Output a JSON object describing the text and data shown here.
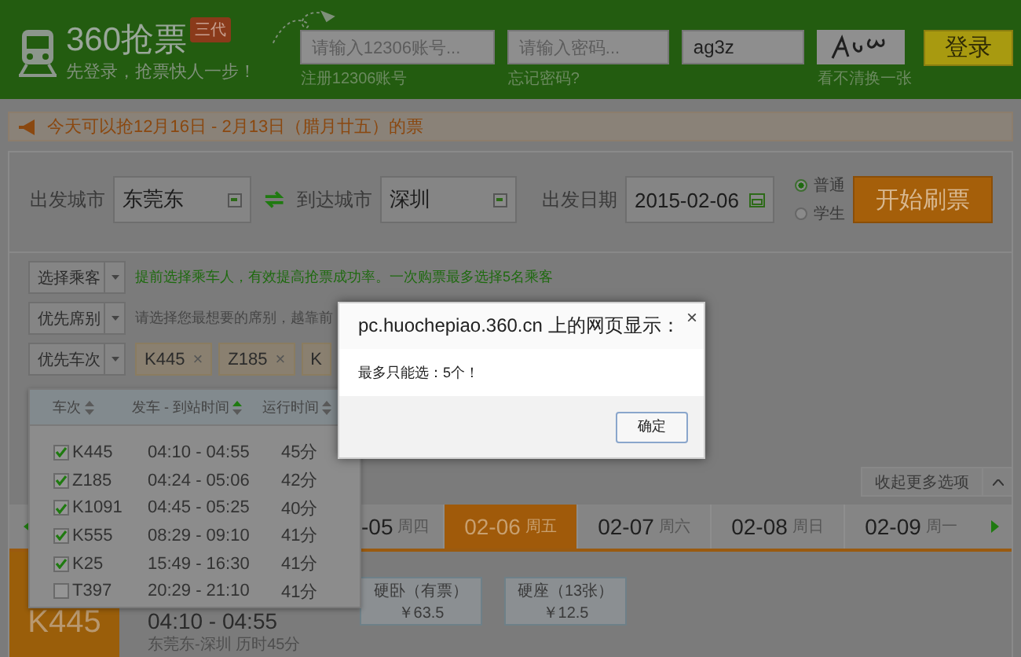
{
  "header": {
    "logo_text": "360抢票",
    "badge": "三代",
    "slogan": "先登录，抢票快人一步！",
    "login": {
      "account": {
        "placeholder": "请输入12306账号...",
        "link": "注册12306账号"
      },
      "password": {
        "placeholder": "请输入密码...",
        "link": "忘记密码?"
      },
      "captcha": {
        "value": "ag3z",
        "link": "看不清换一张"
      },
      "login_button": "登录"
    }
  },
  "notice": "今天可以抢12月16日 - 2月13日（腊月廿五）的票",
  "search": {
    "from": {
      "label": "出发城市",
      "value": "东莞东"
    },
    "to": {
      "label": "到达城市",
      "value": "深圳"
    },
    "date": {
      "label": "出发日期",
      "value": "2015-02-06"
    },
    "ticket_types": [
      {
        "label": "普通",
        "selected": true
      },
      {
        "label": "学生",
        "selected": false
      }
    ],
    "start_button": "开始刷票"
  },
  "options": [
    {
      "button": "选择乘客",
      "kind": "tip",
      "hint": "提前选择乘车人，有效提高抢票成功率。一次购票最多选择5名乘客"
    },
    {
      "button": "优先席别",
      "kind": "placeholder",
      "hint": "请选择您最想要的席别，越靠前"
    },
    {
      "button": "优先车次",
      "kind": "chips",
      "chips": [
        {
          "label": "K445",
          "remove": "×"
        },
        {
          "label": "Z185",
          "remove": "×"
        },
        {
          "label": "K"
        }
      ]
    }
  ],
  "train_dropdown": {
    "columns": [
      {
        "label": "车次",
        "sorted": false
      },
      {
        "label": "发车 - 到站时间",
        "sorted": true
      },
      {
        "label": "运行时间",
        "sorted": false
      }
    ],
    "rows": [
      {
        "train": "K445",
        "time": "04:10 - 04:55",
        "duration": "45分",
        "checked": true
      },
      {
        "train": "Z185",
        "time": "04:24 - 05:06",
        "duration": "42分",
        "checked": true
      },
      {
        "train": "K1091",
        "time": "04:45 - 05:25",
        "duration": "40分",
        "checked": true
      },
      {
        "train": "K555",
        "time": "08:29 - 09:10",
        "duration": "41分",
        "checked": true
      },
      {
        "train": "K25",
        "time": "15:49 - 16:30",
        "duration": "41分",
        "checked": true
      },
      {
        "train": "T397",
        "time": "20:29 - 21:10",
        "duration": "41分",
        "checked": false
      }
    ]
  },
  "collapse_tab": "收起更多选项",
  "date_tabs": [
    {
      "date": "-05",
      "weekday": "周四",
      "selected": false
    },
    {
      "date": "02-06",
      "weekday": "周五",
      "selected": true
    },
    {
      "date": "02-07",
      "weekday": "周六",
      "selected": false
    },
    {
      "date": "02-08",
      "weekday": "周日",
      "selected": false
    },
    {
      "date": "02-09",
      "weekday": "周一",
      "selected": false
    }
  ],
  "train_card": {
    "train": "K445",
    "time": "04:10 - 04:55",
    "route": "东莞东-深圳 历时45分",
    "seats": [
      {
        "name": "硬卧（有票）",
        "price": "￥63.5"
      },
      {
        "name": "硬座（13张）",
        "price": "￥12.5"
      }
    ]
  },
  "dialog": {
    "title": "pc.huochepiao.360.cn 上的网页显示：",
    "close": "×",
    "message": "最多只能选：5个！",
    "ok_button": "确定"
  }
}
